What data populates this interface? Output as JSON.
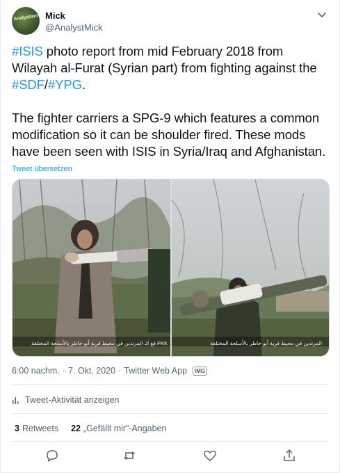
{
  "author": {
    "name": "Mick",
    "handle": "@AnalystMick",
    "avatar_text": "Analystism"
  },
  "tweet": {
    "line1_tag1": "#ISIS",
    "line1_rest": " photo report from mid February 2018 from",
    "line2": "Wilayah al-Furat (Syrian part) from fighting against the",
    "line3_tag1": "#SDF",
    "line3_sep": "/",
    "line3_tag2": "#YPG",
    "line3_end": ".",
    "para2_line1": "The fighter carriers a SPG-9 which features a common",
    "para2_line2": "modification so it can be shoulder fired. These mods",
    "para2_line3": "have been seen with ISIS in Syria/Iraq and Afghanistan.",
    "translate_label": "Tweet übersetzen"
  },
  "media": {
    "caption_left": "PKK قع الـ المرتدين في محيط قرية أبو خاطر بالأسلحة المختلفة",
    "caption_right": "المرتدين في محيط قرية أبو خاطر بالأسلحة المختلفة"
  },
  "meta": {
    "time": "6:00 nachm.",
    "date": "7. Okt. 2020",
    "source": "Twitter Web App",
    "badge": "IMG"
  },
  "activity_label": "Tweet-Aktivität anzeigen",
  "stats": {
    "retweets_count": "3",
    "retweets_label": "Retweets",
    "likes_count": "22",
    "likes_label": "„Gefällt mir“-Angaben"
  },
  "icons": {
    "more": "chevron-down-icon",
    "reply": "reply-icon",
    "retweet": "retweet-icon",
    "like": "heart-icon",
    "share": "share-icon",
    "activity": "bar-chart-icon"
  },
  "colors": {
    "accent": "#1d9bf0",
    "secondary_text": "#536471"
  }
}
